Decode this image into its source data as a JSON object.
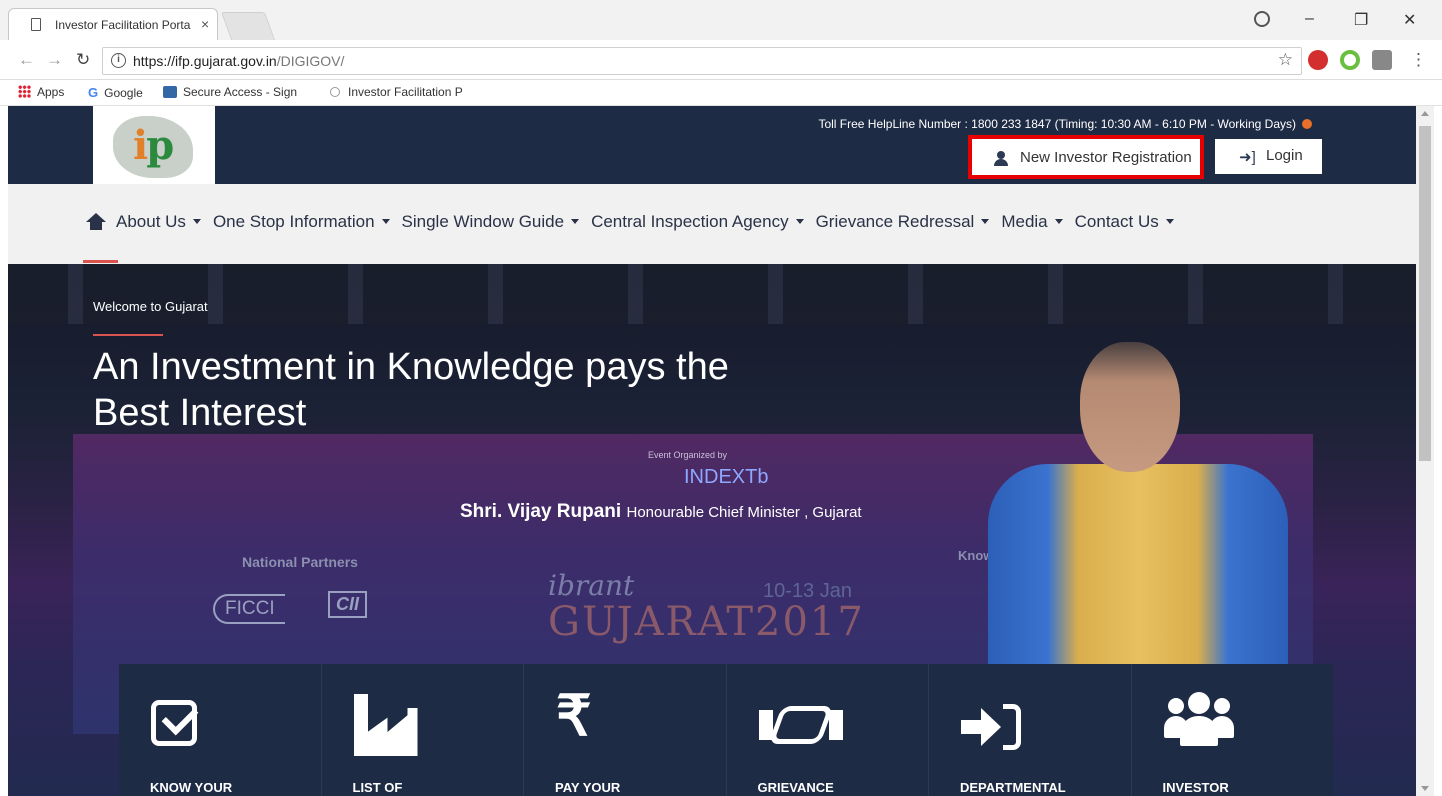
{
  "browser": {
    "tab_title": "Investor Facilitation Porta",
    "tab_close": "×",
    "url_host": "https://ifp.gujarat.gov.in",
    "url_path": "/DIGIGOV/",
    "window_controls": [
      "–",
      "❐",
      "✕"
    ],
    "bookmarks": [
      {
        "label": "Apps",
        "icon": "apps-icon"
      },
      {
        "label": "Google",
        "icon": "google-icon"
      },
      {
        "label": "Secure Access - Sign",
        "icon": "tata-icon"
      },
      {
        "label": "Investor Facilitation P",
        "icon": "globe-icon"
      }
    ]
  },
  "header": {
    "logo_text_i": "i",
    "logo_text_p": "p",
    "helpline": "Toll Free HelpLine Number : 1800 233 1847 (Timing: 10:30 AM - 6:10 PM - Working Days)",
    "register_label": "New Investor Registration",
    "login_label": "Login"
  },
  "nav": {
    "items": [
      "About Us",
      "One Stop Information",
      "Single Window Guide",
      "Central Inspection Agency",
      "Grievance Redressal",
      "Media",
      "Contact Us"
    ]
  },
  "hero": {
    "welcome": "Welcome to Gujarat",
    "title": "An Investment in Knowledge pays the Best Interest",
    "event_org": "Event Organized by",
    "indextb": "INDEXTb",
    "cm_name": "Shri. Vijay Rupani",
    "cm_role": "Honourable Chief Minister , Gujarat",
    "partners": "National Partners",
    "ficci": "FICCI",
    "cii": "CII",
    "vibrant": "ibrant",
    "gujarat": "GUJARAT2017",
    "dates": "10-13 Jan",
    "knowledge": "Knowledg"
  },
  "tiles": [
    {
      "label": "KNOW YOUR",
      "icon": "checkbox-icon"
    },
    {
      "label": "LIST OF",
      "icon": "factory-icon"
    },
    {
      "label": "PAY YOUR",
      "icon": "rupee-icon"
    },
    {
      "label": "GRIEVANCE",
      "icon": "handshake-icon"
    },
    {
      "label": "DEPARTMENTAL",
      "icon": "sign-in-icon"
    },
    {
      "label": "INVESTOR",
      "icon": "users-icon"
    }
  ],
  "colors": {
    "header_bg": "#1e2b45",
    "highlight_border": "#e60000",
    "accent_red": "#d9534f"
  }
}
